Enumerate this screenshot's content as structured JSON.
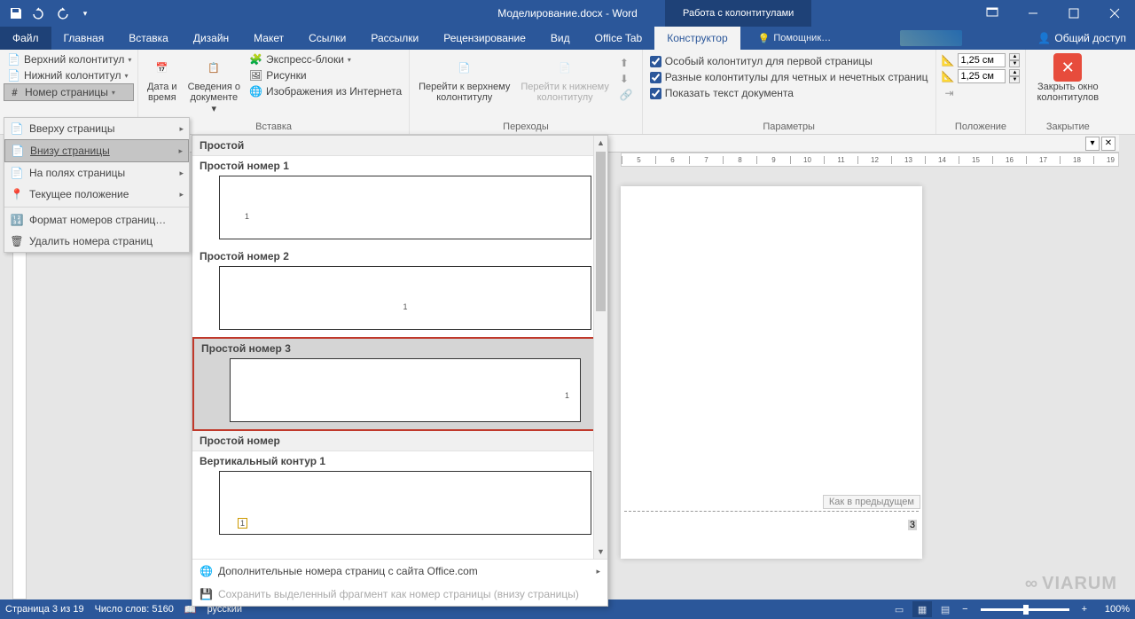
{
  "titlebar": {
    "document_title": "Моделирование.docx - Word",
    "tools_title": "Работа с колонтитулами"
  },
  "tabs": {
    "file": "Файл",
    "home": "Главная",
    "insert": "Вставка",
    "design": "Дизайн",
    "layout": "Макет",
    "references": "Ссылки",
    "mailings": "Рассылки",
    "review": "Рецензирование",
    "view": "Вид",
    "office_tab": "Office Tab",
    "designer": "Конструктор",
    "tell_me": "Помощник…",
    "share": "Общий доступ"
  },
  "ribbon": {
    "hf": {
      "header": "Верхний колонтитул",
      "footer": "Нижний колонтитул",
      "page_number": "Номер страницы"
    },
    "insert": {
      "date_time": "Дата и\nвремя",
      "doc_info": "Сведения о\nдокументе",
      "quick_parts": "Экспресс-блоки",
      "pictures": "Рисунки",
      "online_pictures": "Изображения из Интернета",
      "group_label": "Вставка"
    },
    "nav": {
      "goto_header": "Перейти к верхнему\nколонтитулу",
      "goto_footer": "Перейти к нижнему\nколонтитулу",
      "group_label": "Переходы"
    },
    "options": {
      "different_first": "Особый колонтитул для первой страницы",
      "different_odd_even": "Разные колонтитулы для четных и нечетных страниц",
      "show_document": "Показать текст документа",
      "group_label": "Параметры"
    },
    "position": {
      "header_top": "1,25 см",
      "footer_bottom": "1,25 см",
      "group_label": "Положение"
    },
    "close": {
      "label": "Закрыть окно\nколонтитулов",
      "group_label": "Закрытие"
    }
  },
  "submenu": {
    "top": "Вверху страницы",
    "bottom": "Внизу страницы",
    "margins": "На полях страницы",
    "current": "Текущее положение",
    "format": "Формат номеров страниц…",
    "remove": "Удалить номера страниц"
  },
  "gallery": {
    "section1": "Простой",
    "item1": "Простой номер 1",
    "item2": "Простой номер 2",
    "item3": "Простой номер 3",
    "section2": "Простой номер",
    "item4": "Вертикальный контур 1",
    "more": "Дополнительные номера страниц с сайта Office.com",
    "save_sel": "Сохранить выделенный фрагмент как номер страницы (внизу страницы)"
  },
  "ruler_numbers": [
    "5",
    "6",
    "7",
    "8",
    "9",
    "10",
    "11",
    "12",
    "13",
    "14",
    "15",
    "16",
    "17",
    "18",
    "19"
  ],
  "page": {
    "same_as_prev": "Как в предыдущем",
    "field_value": "3"
  },
  "doc_tab": {
    "name": "Моделирование.docx"
  },
  "statusbar": {
    "page": "Страница 3 из 19",
    "words": "Число слов: 5160",
    "lang": "русский",
    "zoom": "100%"
  },
  "watermark": "VIARUM"
}
